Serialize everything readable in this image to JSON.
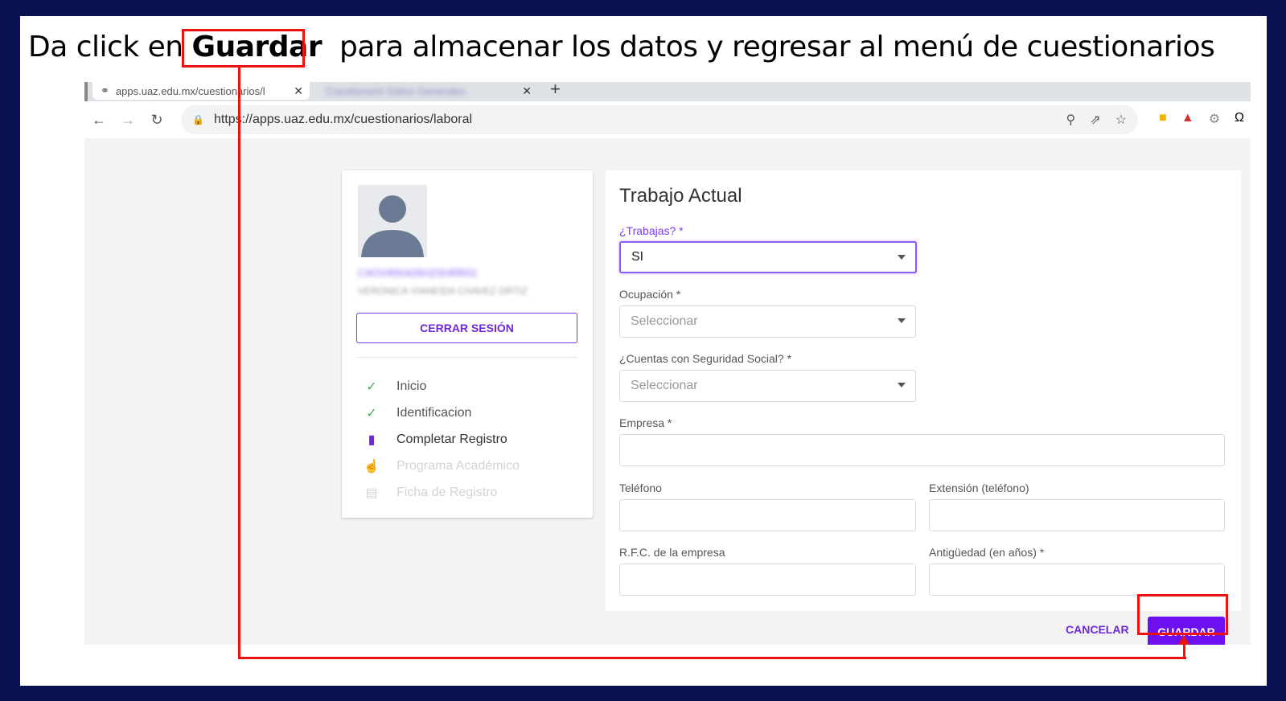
{
  "instruction": {
    "prefix": "Da click en",
    "highlight": "Guardar",
    "suffix": "para almacenar los datos y regresar al menú de cuestionarios"
  },
  "browser": {
    "tabs": [
      {
        "title": "apps.uaz.edu.mx/cuestionarios/l"
      },
      {
        "title": "Cuestionario Datos Generales"
      }
    ],
    "url": "https://apps.uaz.edu.mx/cuestionarios/laboral"
  },
  "profile": {
    "username": "CAOV850426HZSHRR01",
    "fullname": "VERONICA VIANEIDA CHAVEZ ORTIZ",
    "logout_label": "CERRAR SESIÓN",
    "steps": [
      {
        "label": "Inicio",
        "state": "done",
        "icon": "check-icon"
      },
      {
        "label": "Identificacion",
        "state": "done",
        "icon": "check-icon"
      },
      {
        "label": "Completar Registro",
        "state": "current",
        "icon": "book-icon"
      },
      {
        "label": "Programa Académico",
        "state": "disabled",
        "icon": "hand-icon"
      },
      {
        "label": "Ficha de Registro",
        "state": "disabled",
        "icon": "document-icon"
      }
    ]
  },
  "form": {
    "title": "Trabajo Actual",
    "trabajas": {
      "label": "¿Trabajas? *",
      "value": "SI"
    },
    "ocupacion": {
      "label": "Ocupación *",
      "placeholder": "Seleccionar"
    },
    "seguridad_social": {
      "label": "¿Cuentas con Seguridad Social? *",
      "placeholder": "Seleccionar"
    },
    "empresa": {
      "label": "Empresa *"
    },
    "telefono": {
      "label": "Teléfono"
    },
    "extension": {
      "label": "Extensión (teléfono)"
    },
    "rfc": {
      "label": "R.F.C. de la empresa"
    },
    "antiguedad": {
      "label": "Antigüedad (en años) *"
    },
    "cancel_label": "CANCELAR",
    "save_label": "GUARDAR"
  },
  "colors": {
    "accent": "#6d10f0",
    "highlight": "#ee1111",
    "frame": "#0b1254"
  }
}
